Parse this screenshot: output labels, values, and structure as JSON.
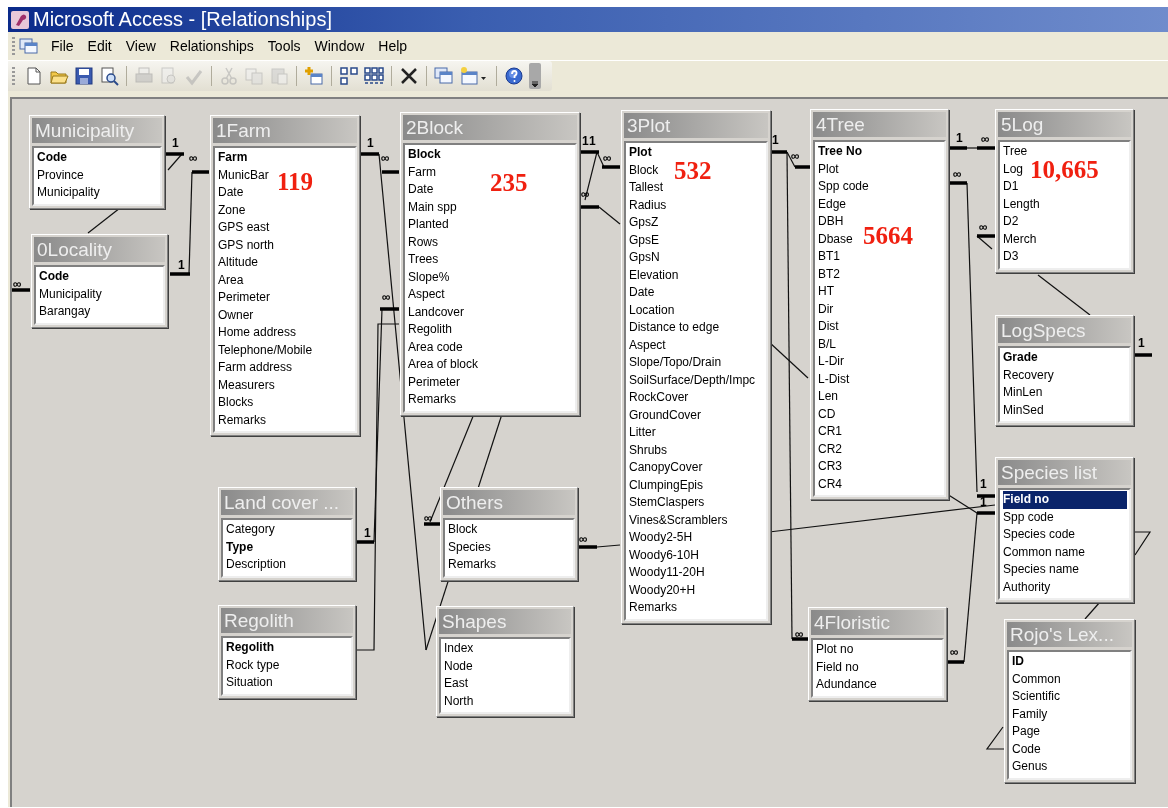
{
  "window": {
    "title": "Microsoft Access - [Relationships]"
  },
  "menu": [
    {
      "label": "File"
    },
    {
      "label": "Edit"
    },
    {
      "label": "View"
    },
    {
      "label": "Relationships"
    },
    {
      "label": "Tools"
    },
    {
      "label": "Window"
    },
    {
      "label": "Help"
    }
  ],
  "toolbar": [
    {
      "kind": "new",
      "disabled": false
    },
    {
      "kind": "open",
      "disabled": false
    },
    {
      "kind": "save",
      "disabled": false
    },
    {
      "kind": "find",
      "disabled": false
    },
    {
      "kind": "separator"
    },
    {
      "kind": "print",
      "disabled": true
    },
    {
      "kind": "preview",
      "disabled": true
    },
    {
      "kind": "spelling",
      "disabled": true
    },
    {
      "kind": "separator"
    },
    {
      "kind": "cut",
      "disabled": true
    },
    {
      "kind": "copy",
      "disabled": true
    },
    {
      "kind": "paste",
      "disabled": true
    },
    {
      "kind": "separator"
    },
    {
      "kind": "show-table",
      "disabled": false
    },
    {
      "kind": "separator"
    },
    {
      "kind": "direct",
      "disabled": false
    },
    {
      "kind": "all",
      "disabled": false
    },
    {
      "kind": "separator"
    },
    {
      "kind": "delete",
      "disabled": false
    },
    {
      "kind": "separator"
    },
    {
      "kind": "database",
      "disabled": false
    },
    {
      "kind": "new-object",
      "disabled": false
    },
    {
      "kind": "separator"
    },
    {
      "kind": "help",
      "disabled": false
    },
    {
      "kind": "options",
      "disabled": false
    }
  ],
  "tables": [
    {
      "title": "Municipality",
      "fields": [
        {
          "name": "Code",
          "key": true,
          "selected": false
        },
        {
          "name": "Province",
          "key": false,
          "selected": false
        },
        {
          "name": "Municipality",
          "key": false,
          "selected": false
        }
      ]
    },
    {
      "title": "0Locality",
      "fields": [
        {
          "name": "Code",
          "key": true,
          "selected": false
        },
        {
          "name": "Municipality",
          "key": false,
          "selected": false
        },
        {
          "name": "Barangay",
          "key": false,
          "selected": false
        }
      ]
    },
    {
      "title": "1Farm",
      "record_count": "119",
      "fields": [
        {
          "name": "Farm",
          "key": true,
          "selected": false
        },
        {
          "name": "MunicBar",
          "key": false,
          "selected": false
        },
        {
          "name": "Date",
          "key": false,
          "selected": false
        },
        {
          "name": "Zone",
          "key": false,
          "selected": false
        },
        {
          "name": "GPS east",
          "key": false,
          "selected": false
        },
        {
          "name": "GPS north",
          "key": false,
          "selected": false
        },
        {
          "name": "Altitude",
          "key": false,
          "selected": false
        },
        {
          "name": "Area",
          "key": false,
          "selected": false
        },
        {
          "name": "Perimeter",
          "key": false,
          "selected": false
        },
        {
          "name": "Owner",
          "key": false,
          "selected": false
        },
        {
          "name": "Home address",
          "key": false,
          "selected": false
        },
        {
          "name": "Telephone/Mobile",
          "key": false,
          "selected": false
        },
        {
          "name": "Farm address",
          "key": false,
          "selected": false
        },
        {
          "name": "Measurers",
          "key": false,
          "selected": false
        },
        {
          "name": "Blocks",
          "key": false,
          "selected": false
        },
        {
          "name": "Remarks",
          "key": false,
          "selected": false
        }
      ]
    },
    {
      "title": "Land cover ...",
      "fields": [
        {
          "name": "Category",
          "key": false,
          "selected": false
        },
        {
          "name": "Type",
          "key": true,
          "selected": false
        },
        {
          "name": "Description",
          "key": false,
          "selected": false
        }
      ]
    },
    {
      "title": "Regolith",
      "fields": [
        {
          "name": "Regolith",
          "key": true,
          "selected": false
        },
        {
          "name": "Rock type",
          "key": false,
          "selected": false
        },
        {
          "name": "Situation",
          "key": false,
          "selected": false
        }
      ]
    },
    {
      "title": "2Block",
      "record_count": "235",
      "fields": [
        {
          "name": "Block",
          "key": true,
          "selected": false
        },
        {
          "name": "Farm",
          "key": false,
          "selected": false
        },
        {
          "name": "Date",
          "key": false,
          "selected": false
        },
        {
          "name": "Main spp",
          "key": false,
          "selected": false
        },
        {
          "name": "Planted",
          "key": false,
          "selected": false
        },
        {
          "name": "Rows",
          "key": false,
          "selected": false
        },
        {
          "name": "Trees",
          "key": false,
          "selected": false
        },
        {
          "name": "Slope%",
          "key": false,
          "selected": false
        },
        {
          "name": "Aspect",
          "key": false,
          "selected": false
        },
        {
          "name": "Landcover",
          "key": false,
          "selected": false
        },
        {
          "name": "Regolith",
          "key": false,
          "selected": false
        },
        {
          "name": "Area code",
          "key": false,
          "selected": false
        },
        {
          "name": "Area of block",
          "key": false,
          "selected": false
        },
        {
          "name": "Perimeter",
          "key": false,
          "selected": false
        },
        {
          "name": "Remarks",
          "key": false,
          "selected": false
        }
      ]
    },
    {
      "title": "Others",
      "fields": [
        {
          "name": "Block",
          "key": false,
          "selected": false
        },
        {
          "name": "Species",
          "key": false,
          "selected": false
        },
        {
          "name": "Remarks",
          "key": false,
          "selected": false
        }
      ]
    },
    {
      "title": "Shapes",
      "fields": [
        {
          "name": "Index",
          "key": false,
          "selected": false
        },
        {
          "name": "Node",
          "key": false,
          "selected": false
        },
        {
          "name": "East",
          "key": false,
          "selected": false
        },
        {
          "name": "North",
          "key": false,
          "selected": false
        }
      ]
    },
    {
      "title": "3Plot",
      "record_count": "532",
      "fields": [
        {
          "name": "Plot",
          "key": true,
          "selected": false
        },
        {
          "name": "Block",
          "key": false,
          "selected": false
        },
        {
          "name": "Tallest",
          "key": false,
          "selected": false
        },
        {
          "name": "Radius",
          "key": false,
          "selected": false
        },
        {
          "name": "GpsZ",
          "key": false,
          "selected": false
        },
        {
          "name": "GpsE",
          "key": false,
          "selected": false
        },
        {
          "name": "GpsN",
          "key": false,
          "selected": false
        },
        {
          "name": "Elevation",
          "key": false,
          "selected": false
        },
        {
          "name": "Date",
          "key": false,
          "selected": false
        },
        {
          "name": "Location",
          "key": false,
          "selected": false
        },
        {
          "name": "Distance to edge",
          "key": false,
          "selected": false
        },
        {
          "name": "Aspect",
          "key": false,
          "selected": false
        },
        {
          "name": "Slope/Topo/Drain",
          "key": false,
          "selected": false
        },
        {
          "name": "SoilSurface/Depth/Impc",
          "key": false,
          "selected": false
        },
        {
          "name": "RockCover",
          "key": false,
          "selected": false
        },
        {
          "name": "GroundCover",
          "key": false,
          "selected": false
        },
        {
          "name": "Litter",
          "key": false,
          "selected": false
        },
        {
          "name": "Shrubs",
          "key": false,
          "selected": false
        },
        {
          "name": "CanopyCover",
          "key": false,
          "selected": false
        },
        {
          "name": "ClumpingEpis",
          "key": false,
          "selected": false
        },
        {
          "name": "StemClaspers",
          "key": false,
          "selected": false
        },
        {
          "name": "Vines&Scramblers",
          "key": false,
          "selected": false
        },
        {
          "name": "Woody2-5H",
          "key": false,
          "selected": false
        },
        {
          "name": "Woody6-10H",
          "key": false,
          "selected": false
        },
        {
          "name": "Woody11-20H",
          "key": false,
          "selected": false
        },
        {
          "name": "Woody20+H",
          "key": false,
          "selected": false
        },
        {
          "name": "Remarks",
          "key": false,
          "selected": false
        }
      ]
    },
    {
      "title": "4Tree",
      "record_count": "5664",
      "fields": [
        {
          "name": "Tree No",
          "key": true,
          "selected": false
        },
        {
          "name": "Plot",
          "key": false,
          "selected": false
        },
        {
          "name": "Spp code",
          "key": false,
          "selected": false
        },
        {
          "name": "Edge",
          "key": false,
          "selected": false
        },
        {
          "name": "DBH",
          "key": false,
          "selected": false
        },
        {
          "name": "Dbase",
          "key": false,
          "selected": false
        },
        {
          "name": "BT1",
          "key": false,
          "selected": false
        },
        {
          "name": "BT2",
          "key": false,
          "selected": false
        },
        {
          "name": "HT",
          "key": false,
          "selected": false
        },
        {
          "name": "Dir",
          "key": false,
          "selected": false
        },
        {
          "name": "Dist",
          "key": false,
          "selected": false
        },
        {
          "name": "B/L",
          "key": false,
          "selected": false
        },
        {
          "name": "L-Dir",
          "key": false,
          "selected": false
        },
        {
          "name": "L-Dist",
          "key": false,
          "selected": false
        },
        {
          "name": "Len",
          "key": false,
          "selected": false
        },
        {
          "name": "CD",
          "key": false,
          "selected": false
        },
        {
          "name": "CR1",
          "key": false,
          "selected": false
        },
        {
          "name": "CR2",
          "key": false,
          "selected": false
        },
        {
          "name": "CR3",
          "key": false,
          "selected": false
        },
        {
          "name": "CR4",
          "key": false,
          "selected": false
        }
      ]
    },
    {
      "title": "4Floristic",
      "fields": [
        {
          "name": "Plot no",
          "key": false,
          "selected": false
        },
        {
          "name": "Field no",
          "key": false,
          "selected": false
        },
        {
          "name": "Adundance",
          "key": false,
          "selected": false
        }
      ]
    },
    {
      "title": "5Log",
      "record_count": "10,665",
      "fields": [
        {
          "name": "Tree",
          "key": false,
          "selected": false
        },
        {
          "name": "Log",
          "key": false,
          "selected": false
        },
        {
          "name": "D1",
          "key": false,
          "selected": false
        },
        {
          "name": "Length",
          "key": false,
          "selected": false
        },
        {
          "name": "D2",
          "key": false,
          "selected": false
        },
        {
          "name": "Merch",
          "key": false,
          "selected": false
        },
        {
          "name": "D3",
          "key": false,
          "selected": false
        }
      ]
    },
    {
      "title": "LogSpecs",
      "fields": [
        {
          "name": "Grade",
          "key": true,
          "selected": false
        },
        {
          "name": "Recovery",
          "key": false,
          "selected": false
        },
        {
          "name": "MinLen",
          "key": false,
          "selected": false
        },
        {
          "name": "MinSed",
          "key": false,
          "selected": false
        }
      ]
    },
    {
      "title": "Species list",
      "fields": [
        {
          "name": "Field no",
          "key": true,
          "selected": true
        },
        {
          "name": "Spp code",
          "key": false,
          "selected": false
        },
        {
          "name": "Species code",
          "key": false,
          "selected": false
        },
        {
          "name": "Common name",
          "key": false,
          "selected": false
        },
        {
          "name": "Species name",
          "key": false,
          "selected": false
        },
        {
          "name": "Authority",
          "key": false,
          "selected": false
        }
      ]
    },
    {
      "title": "Rojo's Lex...",
      "fields": [
        {
          "name": "ID",
          "key": true,
          "selected": false
        },
        {
          "name": "Common",
          "key": false,
          "selected": false
        },
        {
          "name": "Scientific",
          "key": false,
          "selected": false
        },
        {
          "name": "Family",
          "key": false,
          "selected": false
        },
        {
          "name": "Page",
          "key": false,
          "selected": false
        },
        {
          "name": "Code",
          "key": false,
          "selected": false
        },
        {
          "name": "Genus",
          "key": false,
          "selected": false
        }
      ]
    }
  ],
  "join_labels": [
    "1",
    "∞",
    "1",
    "∞",
    "1",
    "∞",
    "∞",
    "1",
    "1",
    "1",
    "∞",
    "∞",
    "∞",
    "∞",
    "1",
    "∞",
    "∞",
    "1",
    "∞",
    "∞",
    "∞",
    "1",
    "1",
    "1",
    "∞"
  ]
}
